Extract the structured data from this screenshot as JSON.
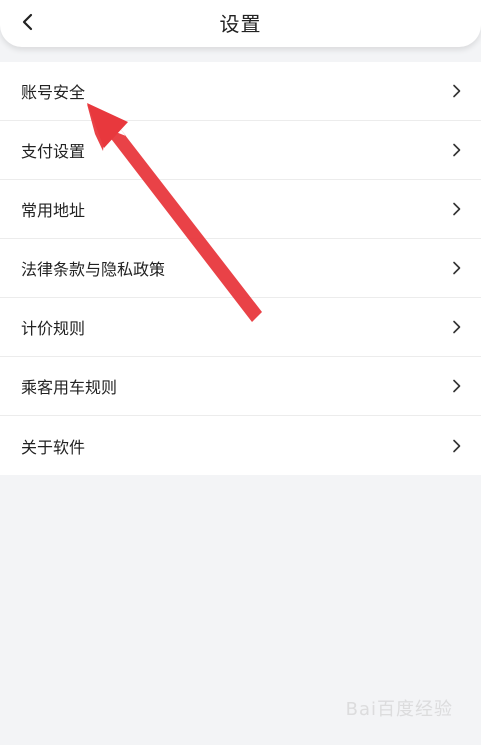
{
  "header": {
    "title": "设置",
    "back_icon": "chevron-left-icon"
  },
  "settings_list": [
    {
      "label": "账号安全"
    },
    {
      "label": "支付设置"
    },
    {
      "label": "常用地址"
    },
    {
      "label": "法律条款与隐私政策"
    },
    {
      "label": "计价规则"
    },
    {
      "label": "乘客用车规则"
    },
    {
      "label": "关于软件"
    }
  ],
  "annotation": {
    "color": "#e8383d",
    "points_to": "账号安全"
  },
  "watermark": {
    "text": "Bai百度经验"
  },
  "colors": {
    "background": "#f3f4f6",
    "card": "#ffffff",
    "text": "#222222",
    "divider": "#ececec"
  }
}
